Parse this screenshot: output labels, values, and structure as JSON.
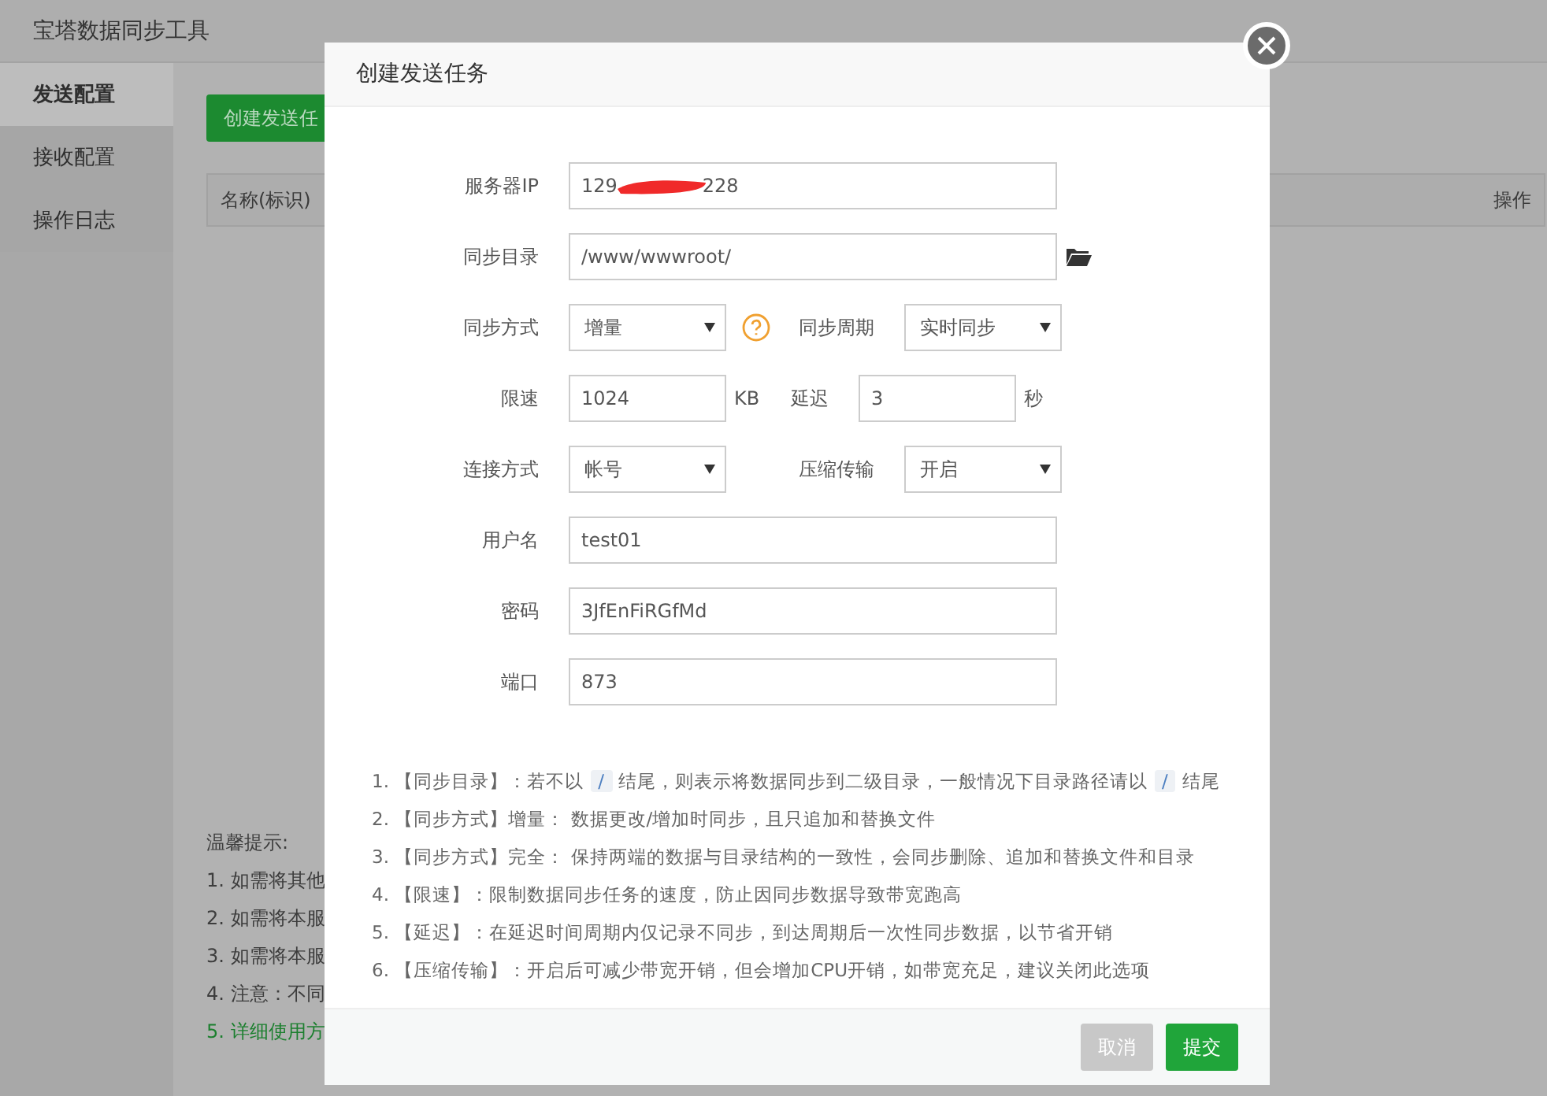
{
  "app": {
    "title": "宝塔数据同步工具"
  },
  "sidebar": {
    "items": [
      {
        "label": "发送配置",
        "selected": true
      },
      {
        "label": "接收配置",
        "selected": false
      },
      {
        "label": "操作日志",
        "selected": false
      }
    ]
  },
  "main": {
    "create_button": "创建发送任",
    "table": {
      "columns": [
        "名称(标识)",
        "操作"
      ]
    },
    "tips": {
      "title": "温馨提示:",
      "items": [
        {
          "text": "1. 如需将其他",
          "kind": "plain"
        },
        {
          "text": "2. 如需将本服",
          "kind": "plain"
        },
        {
          "text": "3. 如需将本服",
          "kind": "plain"
        },
        {
          "text": "4. 注意：不同",
          "kind": "plain"
        },
        {
          "text": "5. 详细使用方",
          "kind": "link"
        }
      ]
    }
  },
  "dialog": {
    "title": "创建发送任务",
    "rows": [
      {
        "kind": "ip",
        "label": "服务器IP",
        "value_start": "129",
        "value_end": "228"
      },
      {
        "kind": "path",
        "label": "同步目录",
        "value": "/www/wwwroot/"
      },
      {
        "kind": "pair",
        "left": {
          "kind": "select",
          "label": "同步方式",
          "value": "增量",
          "help": true
        },
        "right": {
          "kind": "select",
          "label": "同步周期",
          "value": "实时同步"
        }
      },
      {
        "kind": "pair",
        "left": {
          "kind": "input",
          "label": "限速",
          "value": "1024",
          "unit": "KB"
        },
        "right": {
          "kind": "input",
          "label": "延迟",
          "value": "3",
          "unit": "秒"
        }
      },
      {
        "kind": "pair",
        "left": {
          "kind": "select",
          "label": "连接方式",
          "value": "帐号"
        },
        "right": {
          "kind": "select",
          "label": "压缩传输",
          "value": "开启"
        }
      },
      {
        "kind": "text",
        "label": "用户名",
        "value": "test01"
      },
      {
        "kind": "text",
        "label": "密码",
        "value": "3JfEnFiRGfMd"
      },
      {
        "kind": "text",
        "label": "端口",
        "value": "873"
      }
    ],
    "notes": [
      {
        "parts": [
          {
            "kind": "text",
            "text": "1. 【同步目录】：若不以"
          },
          {
            "kind": "code",
            "text": "/"
          },
          {
            "kind": "text",
            "text": "结尾，则表示将数据同步到二级目录，一般情况下目录路径请以"
          },
          {
            "kind": "code",
            "text": "/"
          },
          {
            "kind": "text",
            "text": "结尾"
          }
        ]
      },
      {
        "parts": [
          {
            "kind": "text",
            "text": "2. 【同步方式】增量： 数据更改/增加时同步，且只追加和替换文件"
          }
        ]
      },
      {
        "parts": [
          {
            "kind": "text",
            "text": "3. 【同步方式】完全： 保持两端的数据与目录结构的一致性，会同步删除、追加和替换文件和目录"
          }
        ]
      },
      {
        "parts": [
          {
            "kind": "text",
            "text": "4. 【限速】：限制数据同步任务的速度，防止因同步数据导致带宽跑高"
          }
        ]
      },
      {
        "parts": [
          {
            "kind": "text",
            "text": "5. 【延迟】：在延迟时间周期内仅记录不同步，到达周期后一次性同步数据，以节省开销"
          }
        ]
      },
      {
        "parts": [
          {
            "kind": "text",
            "text": "6. 【压缩传输】：开启后可减少带宽开销，但会增加CPU开销，如带宽充足，建议关闭此选项"
          }
        ]
      }
    ],
    "buttons": [
      {
        "label": "取消",
        "disabled": true
      },
      {
        "label": "提交",
        "disabled": false
      }
    ]
  }
}
